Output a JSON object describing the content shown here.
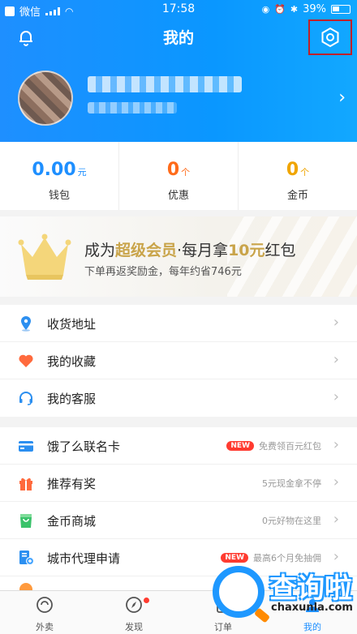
{
  "status_bar": {
    "carrier": "微信",
    "time": "17:58",
    "battery": "39%"
  },
  "nav": {
    "title": "我的"
  },
  "stats": [
    {
      "value": "0.00",
      "unit": "元",
      "label": "钱包",
      "color": "#1e8fff"
    },
    {
      "value": "0",
      "unit": "个",
      "label": "优惠",
      "color": "#ff6b1a"
    },
    {
      "value": "0",
      "unit": "个",
      "label": "金币",
      "color": "#f0a500"
    }
  ],
  "vip": {
    "title_prefix": "成为",
    "title_highlight": "超级会员",
    "title_middle": "·每月拿",
    "title_highlight2": "10元",
    "title_suffix": "红包",
    "subtitle": "下单再返奖励金，每年约省746元"
  },
  "list_a": [
    {
      "label": "收货地址",
      "icon": "location-pin-icon"
    },
    {
      "label": "我的收藏",
      "icon": "heart-icon"
    },
    {
      "label": "我的客服",
      "icon": "headset-icon"
    }
  ],
  "list_b": [
    {
      "label": "饿了么联名卡",
      "icon": "card-icon",
      "badge": "NEW",
      "extra": "免费领百元红包"
    },
    {
      "label": "推荐有奖",
      "icon": "gift-icon",
      "badge": "",
      "extra": "5元现金拿不停"
    },
    {
      "label": "金币商城",
      "icon": "shop-bag-icon",
      "badge": "",
      "extra": "0元好物在这里"
    },
    {
      "label": "城市代理申请",
      "icon": "city-agent-icon",
      "badge": "NEW",
      "extra": "最高6个月免抽佣"
    }
  ],
  "tabbar": [
    {
      "label": "外卖",
      "icon": "takeout-icon",
      "active": false
    },
    {
      "label": "发现",
      "icon": "compass-icon",
      "active": false,
      "dot": true
    },
    {
      "label": "订单",
      "icon": "order-icon",
      "active": false
    },
    {
      "label": "我的",
      "icon": "me-icon",
      "active": true
    }
  ],
  "watermark": {
    "text": "查询啦",
    "sub": "chaxunla.com"
  }
}
